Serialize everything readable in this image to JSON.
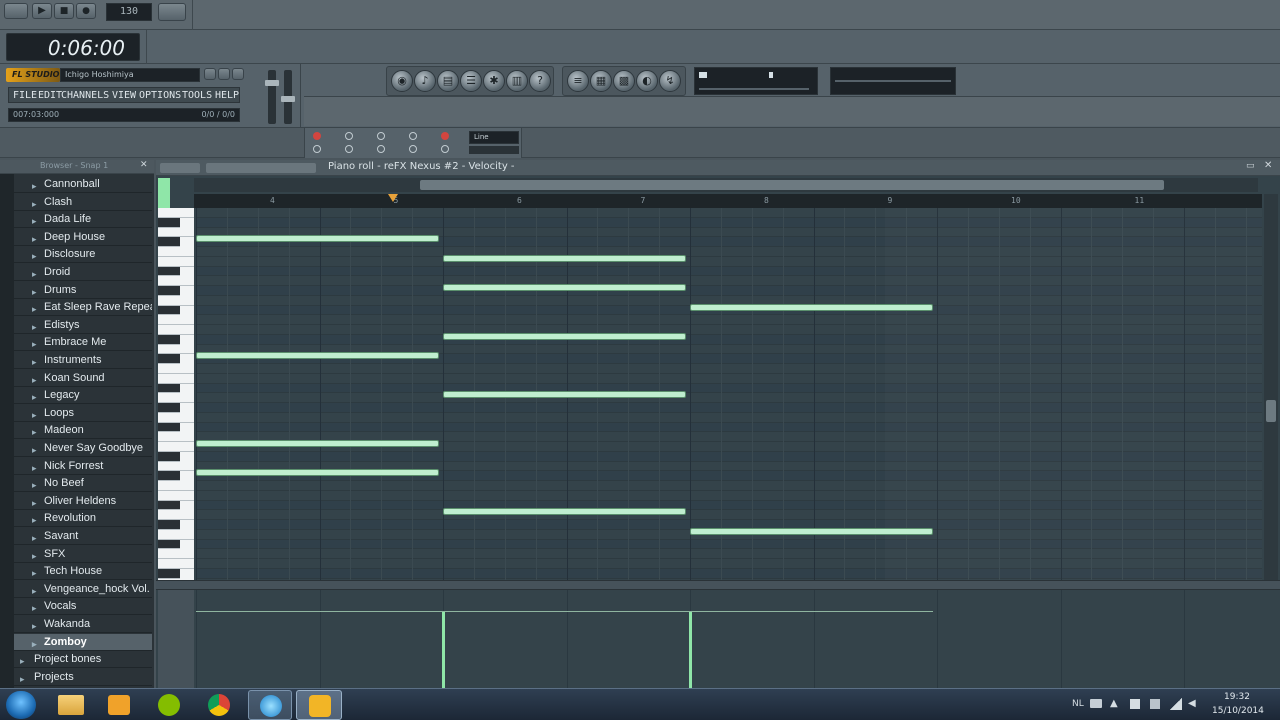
{
  "app": {
    "title_bar_value": "Ichigo Hoshimiya",
    "time_display": "0:06:00",
    "bpm": "130",
    "song_position": "007:03:000",
    "hint_right": "0/0 / 0/0",
    "menu": [
      "FILE",
      "EDIT",
      "CHANNELS",
      "VIEW",
      "OPTIONS",
      "TOOLS",
      "HELP"
    ],
    "snap_value": "Line",
    "logo_text": "FL STUDIO"
  },
  "browser": {
    "header": "Browser - Snap 1",
    "items": [
      {
        "label": "Cannonball",
        "active": false
      },
      {
        "label": "Clash",
        "active": false
      },
      {
        "label": "Dada Life",
        "active": false
      },
      {
        "label": "Deep House",
        "active": false
      },
      {
        "label": "Disclosure",
        "active": false
      },
      {
        "label": "Droid",
        "active": false
      },
      {
        "label": "Drums",
        "active": false
      },
      {
        "label": "Eat Sleep Rave Repeat",
        "active": false
      },
      {
        "label": "Edistys",
        "active": false
      },
      {
        "label": "Embrace Me",
        "active": false
      },
      {
        "label": "Instruments",
        "active": false
      },
      {
        "label": "Koan Sound",
        "active": false
      },
      {
        "label": "Legacy",
        "active": false
      },
      {
        "label": "Loops",
        "active": false
      },
      {
        "label": "Madeon",
        "active": false
      },
      {
        "label": "Never Say Goodbye",
        "active": false
      },
      {
        "label": "Nick Forrest",
        "active": false
      },
      {
        "label": "No Beef",
        "active": false
      },
      {
        "label": "Oliver Heldens",
        "active": false
      },
      {
        "label": "Revolution",
        "active": false
      },
      {
        "label": "Savant",
        "active": false
      },
      {
        "label": "SFX",
        "active": false
      },
      {
        "label": "Tech House",
        "active": false
      },
      {
        "label": "Vengeance_hock Vol. 2",
        "active": false
      },
      {
        "label": "Vocals",
        "active": false
      },
      {
        "label": "Wakanda",
        "active": false
      },
      {
        "label": "Zomboy",
        "active": true
      }
    ],
    "roots": [
      {
        "label": "Project bones"
      },
      {
        "label": "Projects"
      }
    ]
  },
  "piano_roll": {
    "title": "Piano roll - reFX Nexus #2 - Velocity -",
    "bar_numbers": [
      "4",
      "5",
      "6",
      "7",
      "8",
      "9",
      "10",
      "11"
    ],
    "notes": [
      {
        "pitch_row": 3,
        "start": 0,
        "length": 1
      },
      {
        "pitch_row": 5,
        "start": 1,
        "length": 1
      },
      {
        "pitch_row": 8,
        "start": 1,
        "length": 1
      },
      {
        "pitch_row": 10,
        "start": 2,
        "length": 1
      },
      {
        "pitch_row": 13,
        "start": 1,
        "length": 1
      },
      {
        "pitch_row": 15,
        "start": 0,
        "length": 1
      },
      {
        "pitch_row": 19,
        "start": 1,
        "length": 1
      },
      {
        "pitch_row": 24,
        "start": 0,
        "length": 1
      },
      {
        "pitch_row": 27,
        "start": 0,
        "length": 1
      },
      {
        "pitch_row": 31,
        "start": 1,
        "length": 1
      },
      {
        "pitch_row": 33,
        "start": 2,
        "length": 1
      }
    ],
    "velocity_markers": [
      {
        "step": 1,
        "value": 0.78
      },
      {
        "step": 2,
        "value": 0.78
      }
    ]
  },
  "taskbar": {
    "clock_time": "19:32",
    "clock_date": "15/10/2014",
    "lang": "NL",
    "icons": [
      "start-orb",
      "explorer",
      "media-player",
      "spotify",
      "chrome",
      "itunes",
      "fl-studio"
    ]
  },
  "colors": {
    "note_fill": "#bfeecf",
    "grid_bg": "#34434a",
    "accent_green": "#8fe6a8"
  }
}
